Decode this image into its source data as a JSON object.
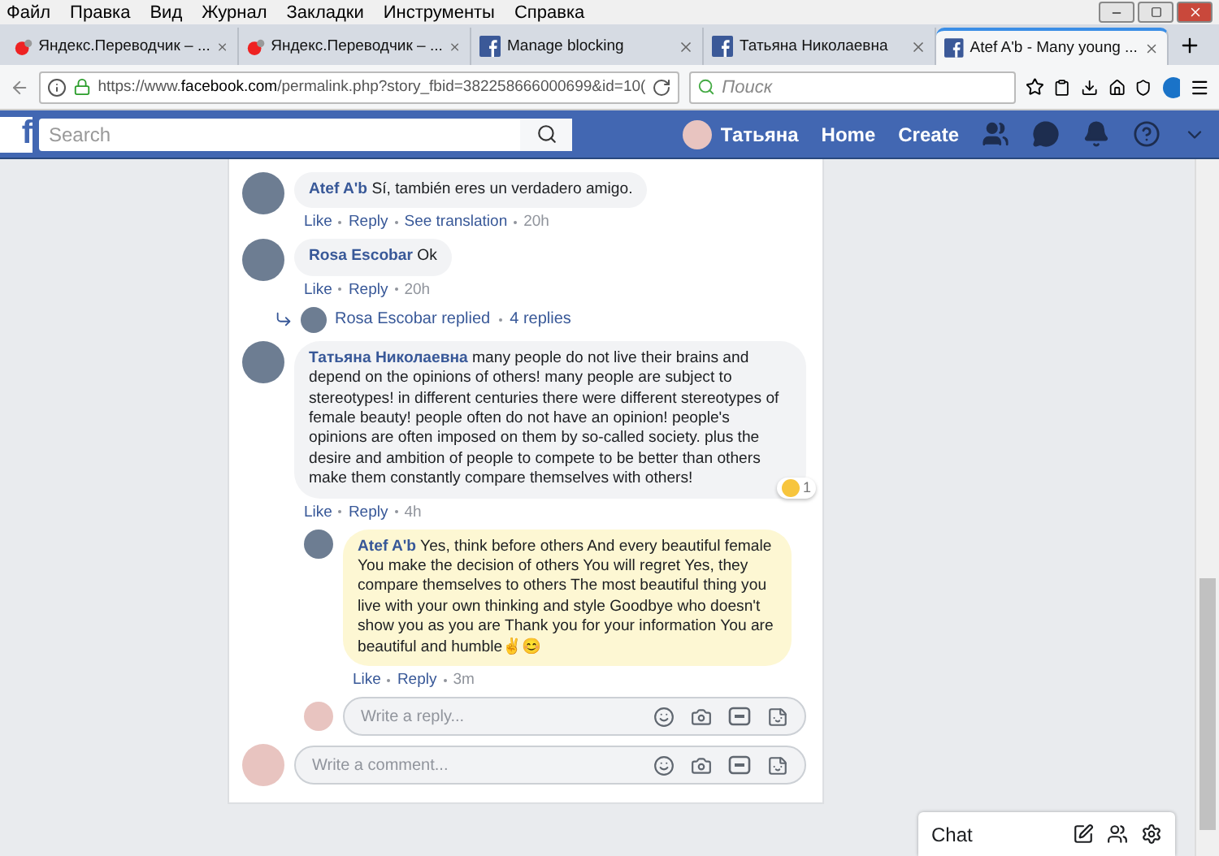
{
  "menu": [
    "Файл",
    "Правка",
    "Вид",
    "Журнал",
    "Закладки",
    "Инструменты",
    "Справка"
  ],
  "tabs": [
    {
      "title": "Яндекс.Переводчик – ...",
      "kind": "yandex",
      "selected": false
    },
    {
      "title": "Яндекс.Переводчик – ...",
      "kind": "yandex",
      "selected": false
    },
    {
      "title": "Manage blocking",
      "kind": "facebook",
      "selected": false
    },
    {
      "title": "Татьяна Николаевна",
      "kind": "facebook",
      "selected": false
    },
    {
      "title": "Atef A'b - Many young ...",
      "kind": "facebook",
      "selected": true
    }
  ],
  "address": {
    "url_prefix": "https://www.",
    "url_domain": "facebook.com",
    "url_rest": "/permalink.php?story_fbid=382258666000699&id=10(",
    "search_placeholder": "Поиск"
  },
  "fb_bar": {
    "logo": "f",
    "search_placeholder": "Search",
    "user": "Татьяна",
    "links": [
      "Home",
      "Create"
    ]
  },
  "comments": [
    {
      "author": "Atef A'b",
      "text": "Sí, también eres un verdadero amigo.",
      "actions": [
        "Like",
        "Reply",
        "See translation"
      ],
      "time": "20h"
    },
    {
      "author": "Rosa Escobar",
      "text": "Ok",
      "actions": [
        "Like",
        "Reply"
      ],
      "time": "20h",
      "replies_summary": {
        "text": "Rosa Escobar replied",
        "count": "4 replies"
      }
    },
    {
      "author": "Татьяна Николаевна",
      "text": "many people do not live their brains and depend on the opinions of others! many people are subject to stereotypes! in different centuries there were different stereotypes of female beauty! people often do not have an opinion! people's opinions are often imposed on them by so-called society. plus the desire and ambition of people to compete to be better than others make them constantly compare themselves with others!",
      "actions": [
        "Like",
        "Reply"
      ],
      "time": "4h",
      "reaction": {
        "count": "1"
      },
      "replies": [
        {
          "author": "Atef A'b",
          "text": "Yes, think before others And every beautiful female You make the decision of others You will regret Yes, they compare themselves to others The most beautiful thing you live with your own thinking and style Goodbye who doesn't show you as you are Thank you for your information You are beautiful and humble✌️😊",
          "actions": [
            "Like",
            "Reply"
          ],
          "time": "3m",
          "highlighted": true
        }
      ],
      "reply_box": {
        "placeholder": "Write a reply..."
      }
    }
  ],
  "comment_box": {
    "placeholder": "Write a comment..."
  },
  "chat": {
    "label": "Chat"
  }
}
